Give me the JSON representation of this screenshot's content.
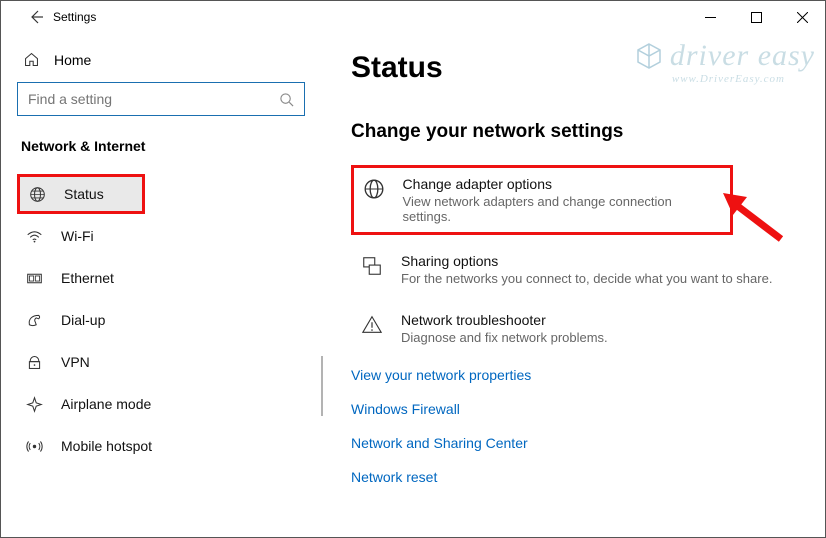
{
  "window": {
    "title": "Settings"
  },
  "sidebar": {
    "home": "Home",
    "search_placeholder": "Find a setting",
    "category": "Network & Internet",
    "items": [
      {
        "label": "Status"
      },
      {
        "label": "Wi-Fi"
      },
      {
        "label": "Ethernet"
      },
      {
        "label": "Dial-up"
      },
      {
        "label": "VPN"
      },
      {
        "label": "Airplane mode"
      },
      {
        "label": "Mobile hotspot"
      }
    ]
  },
  "main": {
    "heading": "Status",
    "subheading": "Change your network settings",
    "options": [
      {
        "title": "Change adapter options",
        "desc": "View network adapters and change connection settings."
      },
      {
        "title": "Sharing options",
        "desc": "For the networks you connect to, decide what you want to share."
      },
      {
        "title": "Network troubleshooter",
        "desc": "Diagnose and fix network problems."
      }
    ],
    "links": [
      "View your network properties",
      "Windows Firewall",
      "Network and Sharing Center",
      "Network reset"
    ]
  },
  "watermark": {
    "brand": "driver easy",
    "url": "www.DriverEasy.com"
  }
}
